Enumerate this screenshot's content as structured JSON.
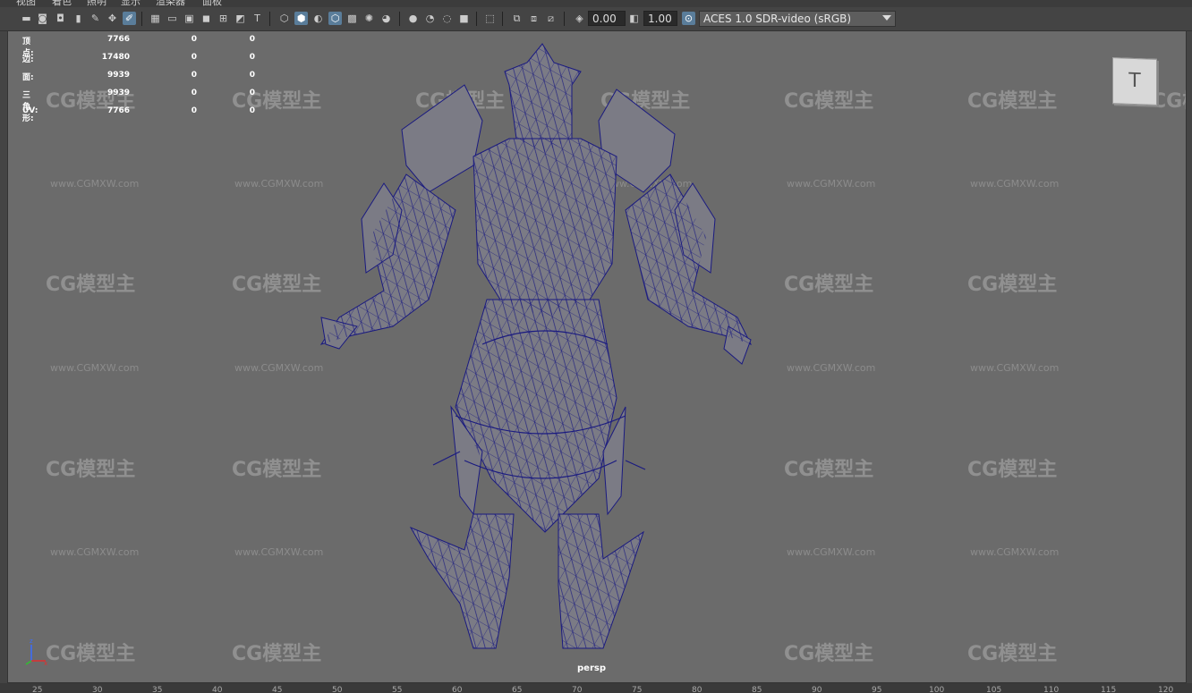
{
  "menu": [
    "视图",
    "着色",
    "照明",
    "显示",
    "渲染器",
    "面板"
  ],
  "toolbar": {
    "exposure": "0.00",
    "gamma": "1.00",
    "colorspace": "ACES 1.0 SDR-video (sRGB)"
  },
  "hud": {
    "rows": [
      {
        "label": "顶点:",
        "v1": "7766",
        "v2": "0",
        "v3": "0"
      },
      {
        "label": "边:",
        "v1": "17480",
        "v2": "0",
        "v3": "0"
      },
      {
        "label": "面:",
        "v1": "9939",
        "v2": "0",
        "v3": "0"
      },
      {
        "label": "三角形:",
        "v1": "9939",
        "v2": "0",
        "v3": "0"
      },
      {
        "label": "UV:",
        "v1": "7766",
        "v2": "0",
        "v3": "0"
      }
    ]
  },
  "watermark": {
    "logo": "CG模型主",
    "url": "www.CGMXW.com"
  },
  "viewcube": {
    "face": "T"
  },
  "camera": "persp",
  "axis": {
    "z": "z",
    "x": "x"
  },
  "timeline_ticks": [
    "25",
    "30",
    "35",
    "40",
    "45",
    "50",
    "55",
    "60",
    "65",
    "70",
    "75",
    "80",
    "85",
    "90",
    "95",
    "100",
    "105",
    "110",
    "115",
    "120"
  ],
  "colors": {
    "mesh": "#1a1a80",
    "viewport": "#6b6b6b",
    "accent": "#5a7d9a"
  }
}
